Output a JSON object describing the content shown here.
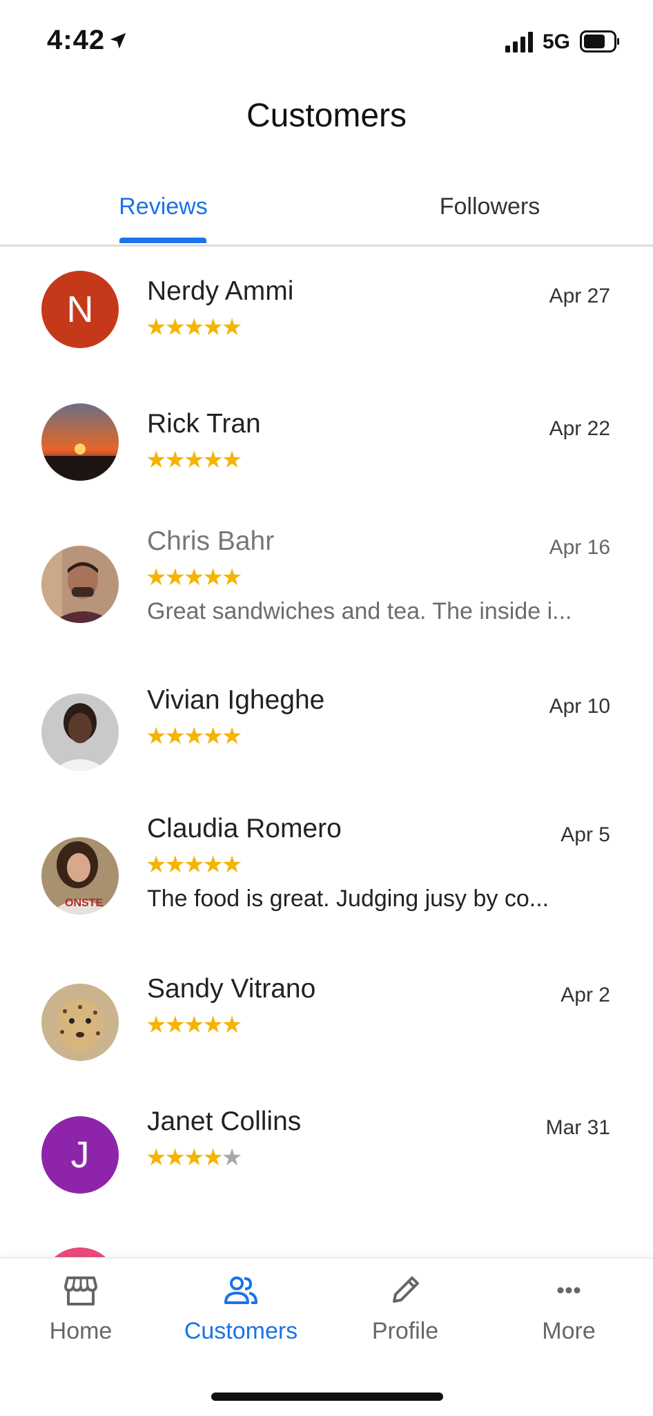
{
  "status": {
    "time": "4:42",
    "network": "5G"
  },
  "header": {
    "title": "Customers"
  },
  "tabs": [
    {
      "label": "Reviews",
      "active": true
    },
    {
      "label": "Followers",
      "active": false
    }
  ],
  "reviews": [
    {
      "name": "Nerdy Ammi",
      "date": "Apr 27",
      "rating": 5,
      "avatar_letter": "N",
      "avatar_color": "#c5391a"
    },
    {
      "name": "Rick Tran",
      "date": "Apr 22",
      "rating": 5,
      "avatar": "sunset-photo"
    },
    {
      "name": "Chris Bahr",
      "date": "Apr 16",
      "rating": 5,
      "avatar": "man-photo",
      "snippet": "Great sandwiches and tea. The inside i..."
    },
    {
      "name": "Vivian Igheghe",
      "date": "Apr 10",
      "rating": 5,
      "avatar": "woman-photo"
    },
    {
      "name": "Claudia Romero",
      "date": "Apr 5",
      "rating": 5,
      "avatar": "woman-photo",
      "snippet": "The food is great. Judging jusy by co..."
    },
    {
      "name": "Sandy Vitrano",
      "date": "Apr 2",
      "rating": 5,
      "avatar": "cheetah-photo"
    },
    {
      "name": "Janet Collins",
      "date": "Mar 31",
      "rating": 4,
      "avatar_letter": "J",
      "avatar_color": "#8e24aa"
    }
  ],
  "bottom_nav": [
    {
      "label": "Home",
      "icon": "storefront-icon",
      "active": false
    },
    {
      "label": "Customers",
      "icon": "people-icon",
      "active": true
    },
    {
      "label": "Profile",
      "icon": "pencil-icon",
      "active": false
    },
    {
      "label": "More",
      "icon": "more-icon",
      "active": false
    }
  ],
  "colors": {
    "accent": "#1a73e8",
    "star": "#f4b400",
    "star_empty": "#a8a8a8"
  }
}
